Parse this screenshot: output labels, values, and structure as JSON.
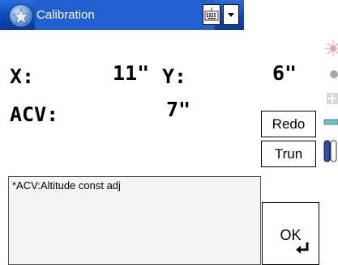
{
  "window": {
    "title": "Calibration",
    "accent": "#0c47b8"
  },
  "icons": {
    "app": "star-orb-icon",
    "keyboard": "keyboard-icon",
    "dropdown": "chevron-down-icon",
    "enter": "enter-arrow-icon"
  },
  "readings": {
    "x_label": "X:",
    "x_value": "11\"",
    "y_label": "Y:",
    "y_value": "6\"",
    "acv_label": "ACV:",
    "acv_value": "7\""
  },
  "buttons": {
    "redo": "Redo",
    "trun": "Trun",
    "ok": "OK"
  },
  "note": {
    "text": "*ACV:Altitude const adj"
  }
}
